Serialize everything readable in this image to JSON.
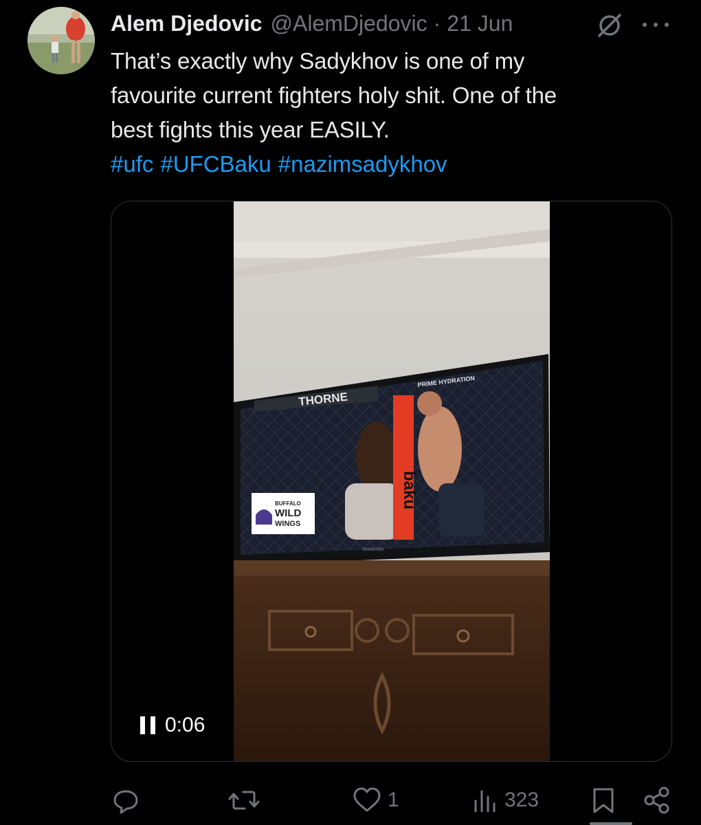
{
  "author": {
    "display_name": "Alem Djedovic",
    "handle": "@AlemDjedovic",
    "separator": "·",
    "date": "21 Jun"
  },
  "tweet": {
    "lines": [
      "That’s exactly why Sadykhov is one of my",
      "favourite current fighters holy shit. One of the",
      "best fights this year EASILY."
    ],
    "hashtags": [
      "#ufc",
      "#UFCBaku",
      "#nazimsadykhov"
    ]
  },
  "video": {
    "time": "0:06",
    "scoreboard_name": "THORNE",
    "sponsor_top": "PRIME HYDRATION",
    "sponsor_logo": [
      "BUFFALO",
      "WILD",
      "WINGS"
    ],
    "banner_text": "baku",
    "tv_brand": "SAMSUNG"
  },
  "actions": {
    "reply_count": "",
    "repost_count": "",
    "like_count": "1",
    "views_count": "323"
  },
  "colors": {
    "background": "#000000",
    "text": "#e7e9ea",
    "secondary": "#71767b",
    "link": "#1d9bf0",
    "border": "#2f3336"
  },
  "icons": {
    "reply": "reply-icon",
    "repost": "repost-icon",
    "like": "heart-icon",
    "views": "views-icon",
    "bookmark": "bookmark-icon",
    "share": "share-icon",
    "grok": "grok-icon",
    "more": "more-icon",
    "pause": "pause-icon"
  }
}
